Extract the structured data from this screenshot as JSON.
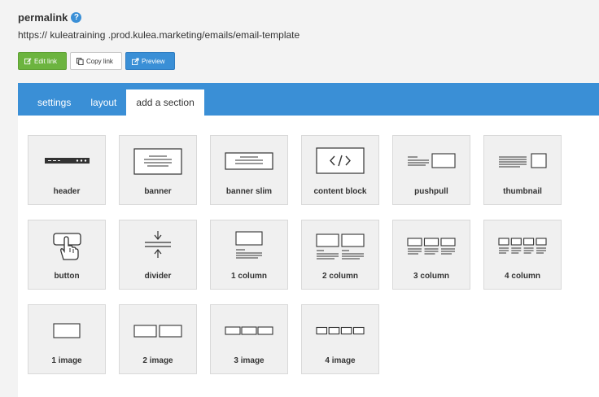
{
  "permalink": {
    "title": "permalink",
    "help_icon": "?",
    "url": "https:// kuleatraining .prod.kulea.marketing/emails/email-template"
  },
  "buttons": {
    "edit": "Edit link",
    "copy": "Copy link",
    "preview": "Preview"
  },
  "colors": {
    "accent_blue": "#3a8fd6",
    "edit_green": "#6cb43f"
  },
  "tabs": [
    {
      "label": "settings",
      "active": false
    },
    {
      "label": "layout",
      "active": false
    },
    {
      "label": "add a section",
      "active": true
    }
  ],
  "sections": [
    {
      "label": "header",
      "icon": "header-icon"
    },
    {
      "label": "banner",
      "icon": "banner-icon"
    },
    {
      "label": "banner slim",
      "icon": "banner-slim-icon"
    },
    {
      "label": "content block",
      "icon": "code-icon"
    },
    {
      "label": "pushpull",
      "icon": "pushpull-icon"
    },
    {
      "label": "thumbnail",
      "icon": "thumbnail-icon"
    },
    {
      "label": "button",
      "icon": "pointer-hand-icon"
    },
    {
      "label": "divider",
      "icon": "divider-icon"
    },
    {
      "label": "1 column",
      "icon": "one-column-icon"
    },
    {
      "label": "2 column",
      "icon": "two-column-icon"
    },
    {
      "label": "3 column",
      "icon": "three-column-icon"
    },
    {
      "label": "4 column",
      "icon": "four-column-icon"
    },
    {
      "label": "1 image",
      "icon": "one-image-icon"
    },
    {
      "label": "2 image",
      "icon": "two-image-icon"
    },
    {
      "label": "3 image",
      "icon": "three-image-icon"
    },
    {
      "label": "4 image",
      "icon": "four-image-icon"
    }
  ]
}
